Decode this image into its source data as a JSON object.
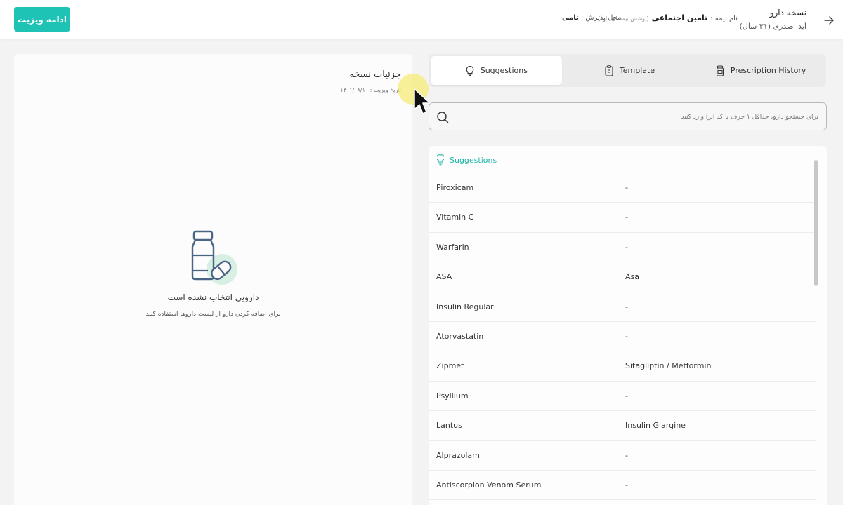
{
  "header": {
    "continue_label": "ادامه ویزیت",
    "rx_title": "نسخه دارو",
    "patient": "آیدا صدری (۳۱ سال)",
    "insurance_label": "نام بیمه :",
    "insurance_value": "تامین اجتماعی",
    "insurance_note": "(پوشش بیمه ای دارد)",
    "reception_label": "محل پذیرش :",
    "reception_value": "تامی"
  },
  "details": {
    "title": "جزئیات نسخه",
    "visit_date": "تاریخ ویزیت : ۱۴۰۱/۰۸/۱۰",
    "empty_title": "دارویی انتخاب نشده است",
    "empty_hint": "برای اضافه کردن دارو از لیست داروها استفاده کنید"
  },
  "tabs": [
    {
      "label": "Suggestions",
      "icon": "lightbulb-icon",
      "active": true
    },
    {
      "label": "Template",
      "icon": "template-icon",
      "active": false
    },
    {
      "label": "Prescription History",
      "icon": "pill-bottle-icon",
      "active": false
    }
  ],
  "search": {
    "placeholder": "برای جستجو دارو، حداقل ۱ حرف یا کد آنرا وارد کنید"
  },
  "suggestions": {
    "heading": "Suggestions",
    "rows": [
      {
        "drug": "Piroxicam",
        "generic": "-"
      },
      {
        "drug": "Vitamin C",
        "generic": "-"
      },
      {
        "drug": "Warfarin",
        "generic": "-"
      },
      {
        "drug": "ASA",
        "generic": "Asa"
      },
      {
        "drug": "Insulin Regular",
        "generic": "-"
      },
      {
        "drug": "Atorvastatin",
        "generic": "-"
      },
      {
        "drug": "Zipmet",
        "generic": "Sitagliptin / Metformin"
      },
      {
        "drug": "Psyllium",
        "generic": "-"
      },
      {
        "drug": "Lantus",
        "generic": "Insulin Glargine"
      },
      {
        "drug": "Alprazolam",
        "generic": "-"
      },
      {
        "drug": "Antiscorpion Venom Serum",
        "generic": "-"
      }
    ]
  },
  "colors": {
    "accent": "#1fc3b5",
    "accent_text": "#1fb5aa"
  }
}
